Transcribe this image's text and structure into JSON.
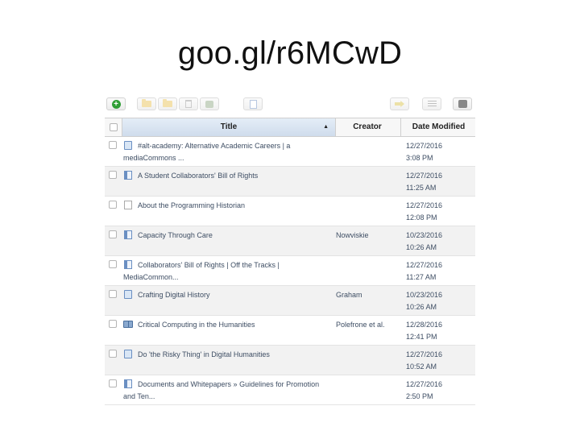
{
  "slide": {
    "title": "goo.gl/r6MCwD"
  },
  "toolbar": {
    "buttons": [
      {
        "name": "add-item-button",
        "icon": "plus-icon"
      },
      {
        "name": "new-collection-button",
        "icon": "folder-icon"
      },
      {
        "name": "new-subcollection-button",
        "icon": "folder-icon"
      },
      {
        "name": "delete-button",
        "icon": "trash-icon"
      },
      {
        "name": "tag-button",
        "icon": "tag-icon"
      },
      {
        "name": "attach-button",
        "icon": "document-icon"
      },
      {
        "name": "export-button",
        "icon": "arrow-icon"
      },
      {
        "name": "list-view-button",
        "icon": "list-icon"
      },
      {
        "name": "sync-button",
        "icon": "tray-icon"
      }
    ]
  },
  "table": {
    "columns": {
      "title": "Title",
      "creator": "Creator",
      "date": "Date Modified"
    },
    "sort_indicator": "▲",
    "rows": [
      {
        "icon": "webpage-icon",
        "title": "#alt-academy: Alternative Academic Careers | a mediaCommons ...",
        "creator": "",
        "date": "12/27/2016",
        "time": "3:08 PM"
      },
      {
        "icon": "report-icon",
        "title": "A Student Collaborators' Bill of Rights",
        "creator": "",
        "date": "12/27/2016",
        "time": "11:25 AM"
      },
      {
        "icon": "document-icon",
        "title": "About the Programming Historian",
        "creator": "",
        "date": "12/27/2016",
        "time": "12:08 PM"
      },
      {
        "icon": "report-icon",
        "title": "Capacity Through Care",
        "creator": "Nowviskie",
        "date": "10/23/2016",
        "time": "10:26 AM"
      },
      {
        "icon": "report-icon",
        "title": "Collaborators' Bill of Rights | Off the Tracks | MediaCommon...",
        "creator": "",
        "date": "12/27/2016",
        "time": "11:27 AM"
      },
      {
        "icon": "webpage-icon",
        "title": "Crafting Digital History",
        "creator": "Graham",
        "date": "10/23/2016",
        "time": "10:26 AM"
      },
      {
        "icon": "book-icon",
        "title": "Critical Computing in the Humanities",
        "creator": "Polefrone et al.",
        "date": "12/28/2016",
        "time": "12:41 PM"
      },
      {
        "icon": "webpage-icon",
        "title": "Do 'the Risky Thing' in Digital Humanities",
        "creator": "",
        "date": "12/27/2016",
        "time": "10:52 AM"
      },
      {
        "icon": "report-icon",
        "title": "Documents and Whitepapers » Guidelines for Promotion and Ten...",
        "creator": "",
        "date": "12/27/2016",
        "time": "2:50 PM"
      }
    ]
  }
}
